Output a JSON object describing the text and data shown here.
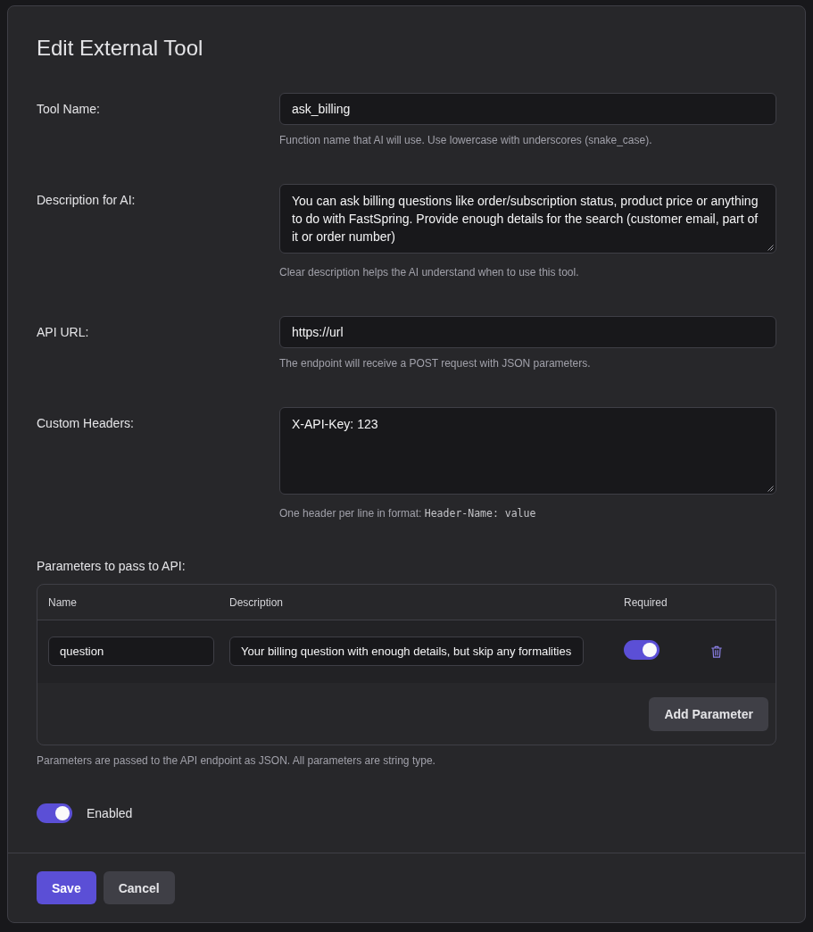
{
  "dialog": {
    "title": "Edit External Tool"
  },
  "fields": [
    {
      "kind": "input",
      "label": "Tool Name:",
      "value": "ask_billing",
      "hint": "Function name that AI will use. Use lowercase with underscores (snake_case)."
    },
    {
      "kind": "textarea",
      "label": "Description for AI:",
      "value": "You can ask billing questions like order/subscription status, product price or anything to do with FastSpring. Provide enough details for the search (customer email, part of it or order number)",
      "hint": "Clear description helps the AI understand when to use this tool."
    },
    {
      "kind": "input",
      "label": "API URL:",
      "value": "https://url",
      "hint": "The endpoint will receive a POST request with JSON parameters."
    },
    {
      "kind": "textarea",
      "label": "Custom Headers:",
      "value": "X-API-Key: 123",
      "hint": "One header per line in format:",
      "hint_code": "Header-Name: value"
    }
  ],
  "parameters": {
    "label": "Parameters to pass to API:",
    "columns": [
      "Name",
      "Description",
      "Required"
    ],
    "rows": [
      {
        "name": "question",
        "description": "Your billing question with enough details, but skip any formalities",
        "required": true
      }
    ],
    "add_button": "Add Parameter",
    "note": "Parameters are passed to the API endpoint as JSON. All parameters are string type."
  },
  "enabled": {
    "label": "Enabled",
    "on": true
  },
  "buttons": [
    {
      "label": "Save",
      "kind": "save"
    },
    {
      "label": "Cancel",
      "kind": "cancel"
    }
  ]
}
